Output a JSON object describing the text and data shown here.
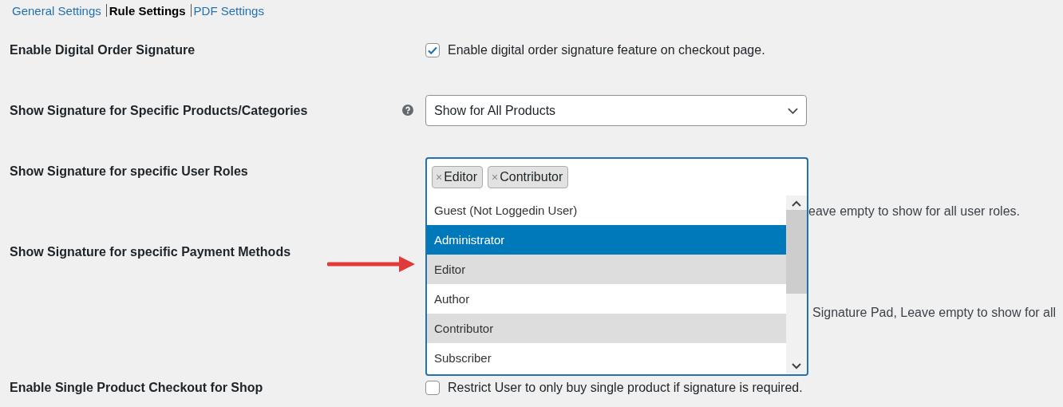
{
  "tabs": [
    {
      "label": "General Settings",
      "selected": false
    },
    {
      "label": "Rule Settings",
      "selected": true
    },
    {
      "label": "PDF Settings",
      "selected": false
    }
  ],
  "settings": [
    {
      "kind": "checkbox",
      "label": "Enable Digital Order Signature",
      "checked": true,
      "text": "Enable digital order signature feature on checkout page."
    },
    {
      "kind": "select",
      "label": "Show Signature for Specific Products/Categories",
      "help": true,
      "value": "Show for All Products"
    },
    {
      "kind": "multiselect",
      "label": "Show Signature for specific User Roles",
      "tags": [
        {
          "remove": "×",
          "label": "Editor"
        },
        {
          "remove": "×",
          "label": "Contributor"
        }
      ],
      "options": [
        {
          "label": "Guest (Not Loggedin User)",
          "highlighted": false,
          "selected": false
        },
        {
          "label": "Administrator",
          "highlighted": true,
          "selected": false
        },
        {
          "label": "Editor",
          "highlighted": false,
          "selected": true
        },
        {
          "label": "Author",
          "highlighted": false,
          "selected": false
        },
        {
          "label": "Contributor",
          "highlighted": false,
          "selected": true
        },
        {
          "label": "Subscriber",
          "highlighted": false,
          "selected": false
        }
      ],
      "description": "eave empty to show for all user roles."
    },
    {
      "kind": "description",
      "label": "Show Signature for specific Payment Methods",
      "description": "Signature Pad, Leave empty to show for all"
    },
    {
      "kind": "checkbox",
      "label": "Enable Single Product Checkout for Shop",
      "checked": false,
      "text": "Restrict User to only buy single product if signature is required."
    }
  ]
}
